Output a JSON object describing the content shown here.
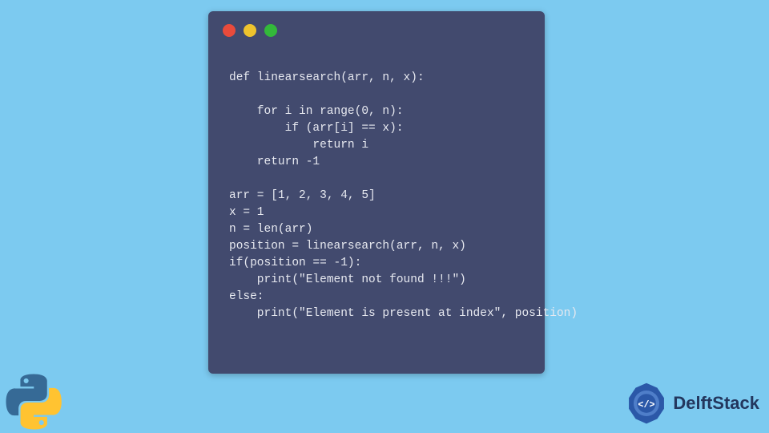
{
  "window": {
    "dots": [
      "red",
      "yellow",
      "green"
    ]
  },
  "code": {
    "lines": "def linearsearch(arr, n, x):\n\n    for i in range(0, n):\n        if (arr[i] == x):\n            return i\n    return -1\n\narr = [1, 2, 3, 4, 5]\nx = 1\nn = len(arr)\nposition = linearsearch(arr, n, x)\nif(position == -1):\n    print(\"Element not found !!!\")\nelse:\n    print(\"Element is present at index\", position)"
  },
  "brand": {
    "name": "DelftStack"
  },
  "icons": {
    "python": "python-logo-icon",
    "delftstack": "delftstack-gear-icon"
  },
  "colors": {
    "background": "#7ccaf0",
    "window_bg": "#424a6e",
    "code_text": "#e7e9f0",
    "dot_red": "#e94b3c",
    "dot_yellow": "#eec32d",
    "dot_green": "#33b93a",
    "python_blue": "#366a96",
    "python_yellow": "#ffc331",
    "brand_text": "#23375e",
    "brand_accent": "#2b58a8"
  }
}
